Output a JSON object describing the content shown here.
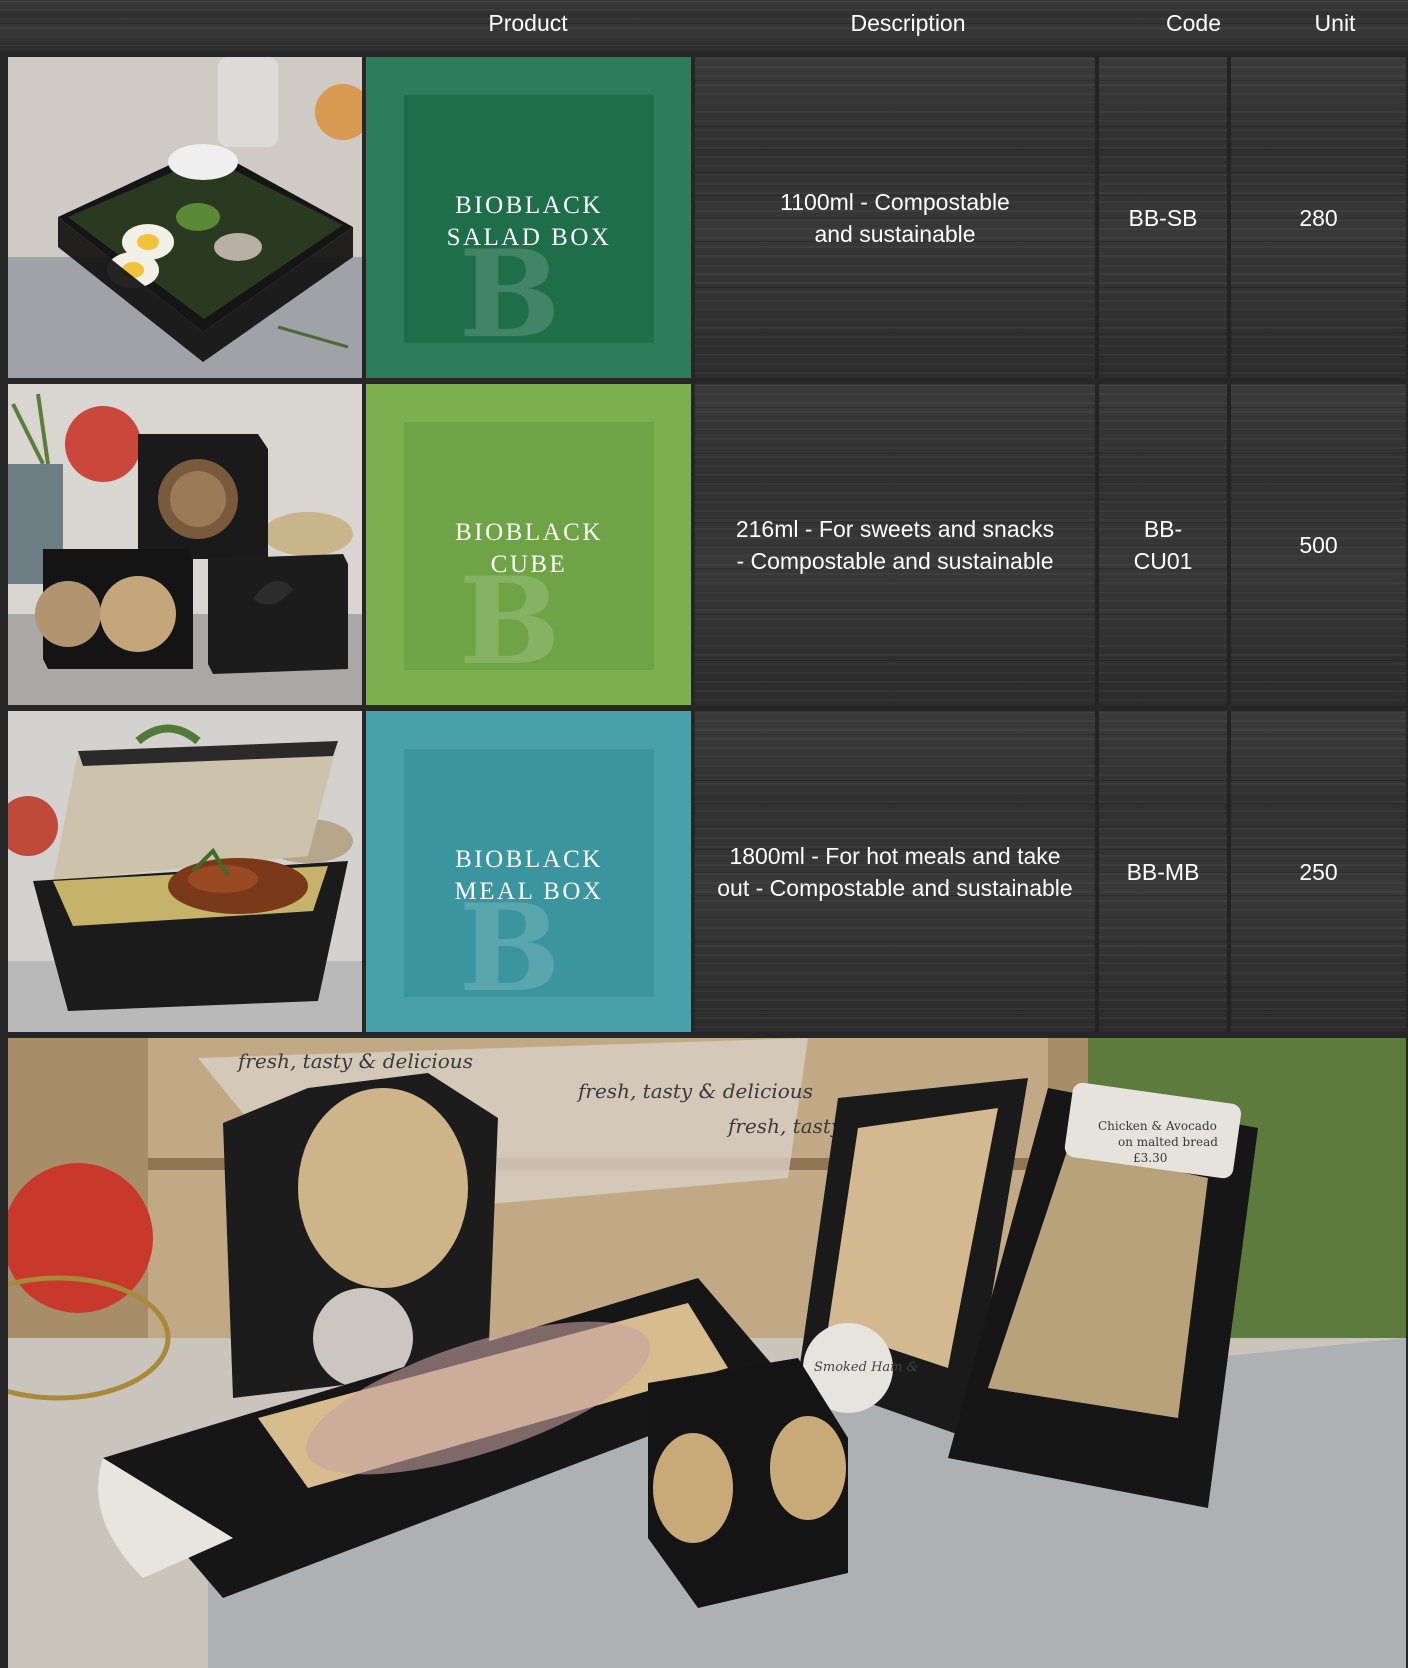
{
  "header": {
    "product": "Product",
    "description": "Description",
    "code": "Code",
    "unit": "Unit"
  },
  "rows": [
    {
      "name_line1": "BIOBLACK",
      "name_line2": "SALAD BOX",
      "description_line1": "1100ml - Compostable",
      "description_line2": "and sustainable",
      "code_line1": "BB-SB",
      "code_line2": "",
      "unit": "280",
      "label_color": "#2e7d5a",
      "label_inner_color": "#1e6e49"
    },
    {
      "name_line1": "BIOBLACK",
      "name_line2": "CUBE",
      "description_line1": "216ml - For sweets and snacks",
      "description_line2": "- Compostable and sustainable",
      "code_line1": "BB-",
      "code_line2": "CU01",
      "unit": "500",
      "label_color": "#7cb04f",
      "label_inner_color": "#6ea446"
    },
    {
      "name_line1": "BIOBLACK",
      "name_line2": "MEAL BOX",
      "description_line1": "1800ml - For hot meals and take",
      "description_line2": "out - Compostable and sustainable",
      "code_line1": "BB-MB",
      "code_line2": "",
      "unit": "250",
      "label_color": "#48a0aa",
      "label_inner_color": "#3a959e"
    }
  ],
  "bottom_photo": {
    "labels": [
      "fresh, tasty & delicious",
      "Chicken & Avocado",
      "on malted bread",
      "£3.30",
      "Smoked Ham &"
    ]
  }
}
